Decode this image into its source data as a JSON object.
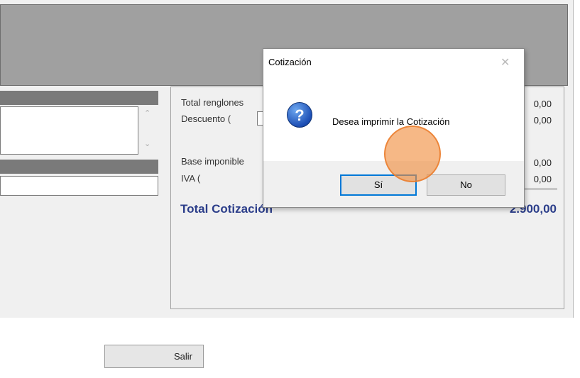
{
  "panel": {
    "rows": [
      {
        "label": "Total renglones",
        "value": "0,00"
      },
      {
        "label": "Descuento  (",
        "value": "0,00"
      },
      {
        "label": "Base imponible",
        "value": "0,00"
      },
      {
        "label": "IVA       (",
        "value": "0,00"
      }
    ],
    "total_label": "Total Cotización",
    "total_value": "2.900,00"
  },
  "dialog": {
    "title": "Cotización",
    "message": "Desea imprimir la Cotización",
    "icon": "question-icon",
    "yes_label": "Sí",
    "no_label": "No"
  },
  "footer": {
    "exit_label": "Salir"
  },
  "colors": {
    "total_text": "#2c3e8a",
    "cursor": "#f08c3c",
    "dialog_focus": "#0078d7"
  }
}
